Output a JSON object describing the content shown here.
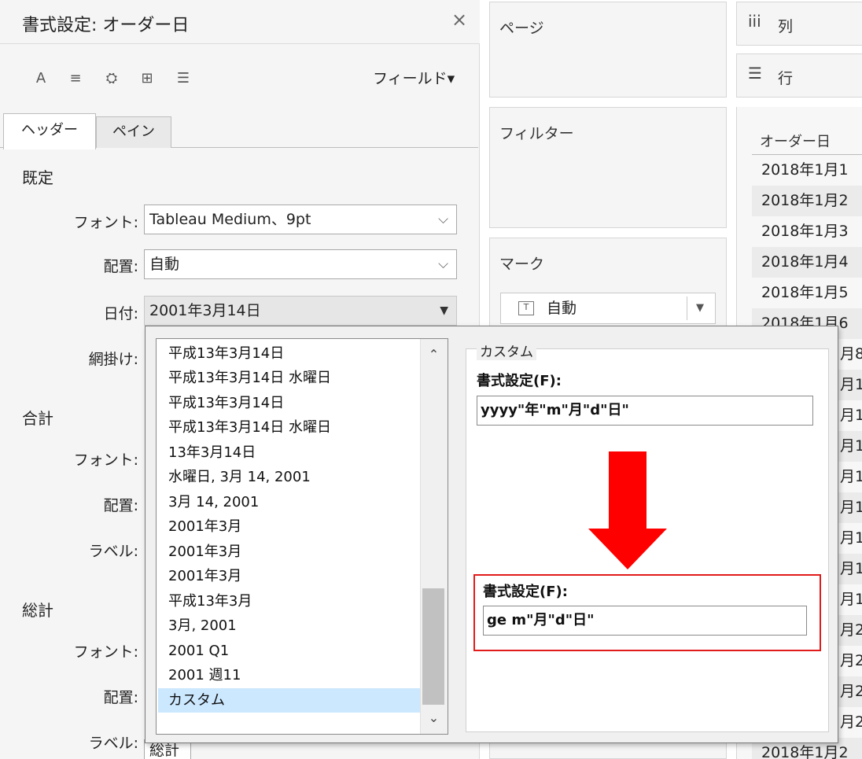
{
  "format_pane": {
    "title": "書式設定: オーダー日",
    "close_label": "×",
    "toolbar": {
      "icons": [
        "font-icon",
        "alignment-icon",
        "shading-icon",
        "borders-icon",
        "lines-icon"
      ],
      "icon_glyphs": [
        "A",
        "≡",
        "⛭",
        "⊞",
        "☰"
      ],
      "field_dropdown_label": "フィールド▾"
    },
    "tabs": [
      {
        "label": "ヘッダー",
        "active": true
      },
      {
        "label": "ペイン",
        "active": false
      }
    ],
    "default_section": {
      "title": "既定",
      "font_label": "フォント:",
      "font_value": "Tableau Medium、9pt",
      "alignment_label": "配置:",
      "alignment_value": "自動",
      "date_label": "日付:",
      "date_value": "2001年3月14日",
      "shading_label": "網掛け:"
    },
    "total_section": {
      "title": "合計",
      "font_label": "フォント:",
      "alignment_label": "配置:",
      "label_label": "ラベル:"
    },
    "grand_total_section": {
      "title": "総計",
      "font_label": "フォント:",
      "alignment_label": "配置:",
      "label_label": "ラベル:",
      "label_value_fragment": "総計"
    }
  },
  "shelves": {
    "pages": "ページ",
    "filters": "フィルター",
    "marks": "マーク",
    "mark_type": "自動",
    "mark_type_icon": "T",
    "columns_icon": "iii",
    "columns": "列",
    "rows_icon": "☰",
    "rows": "行"
  },
  "data_view": {
    "header": "オーダー日",
    "rows": [
      "2018年1月1",
      "2018年1月2",
      "2018年1月3",
      "2018年1月4",
      "2018年1月5",
      "2018年1月6"
    ],
    "fragments": [
      "月8",
      "月1",
      "月1",
      "月1",
      "月1",
      "月1",
      "月1",
      "月1",
      "月1",
      "月2",
      "月2",
      "月2",
      "月2",
      "月2",
      "月2"
    ],
    "last_row": "2018年1月2"
  },
  "date_popup": {
    "formats": [
      "平成13年3月14日",
      "平成13年3月14日 水曜日",
      "平成13年3月14日",
      "平成13年3月14日 水曜日",
      "13年3月14日",
      "水曜日, 3月 14, 2001",
      "3月 14, 2001",
      "2001年3月",
      "2001年3月",
      "2001年3月",
      "平成13年3月",
      "3月, 2001",
      "2001 Q1",
      "2001 週11",
      "カスタム"
    ],
    "selected_index": 14,
    "scroll_up": "⌃",
    "scroll_down": "⌄",
    "custom": {
      "legend": "カスタム",
      "format_label": "書式設定(F):",
      "format_value": "yyyy\"年\"m\"月\"d\"日\"",
      "new_format_label": "書式設定(F):",
      "new_format_value": "ge m\"月\"d\"日\""
    }
  },
  "colors": {
    "arrow": "#ff0000",
    "highlight_border": "#e21b1b",
    "selected_item": "#cce8ff"
  }
}
